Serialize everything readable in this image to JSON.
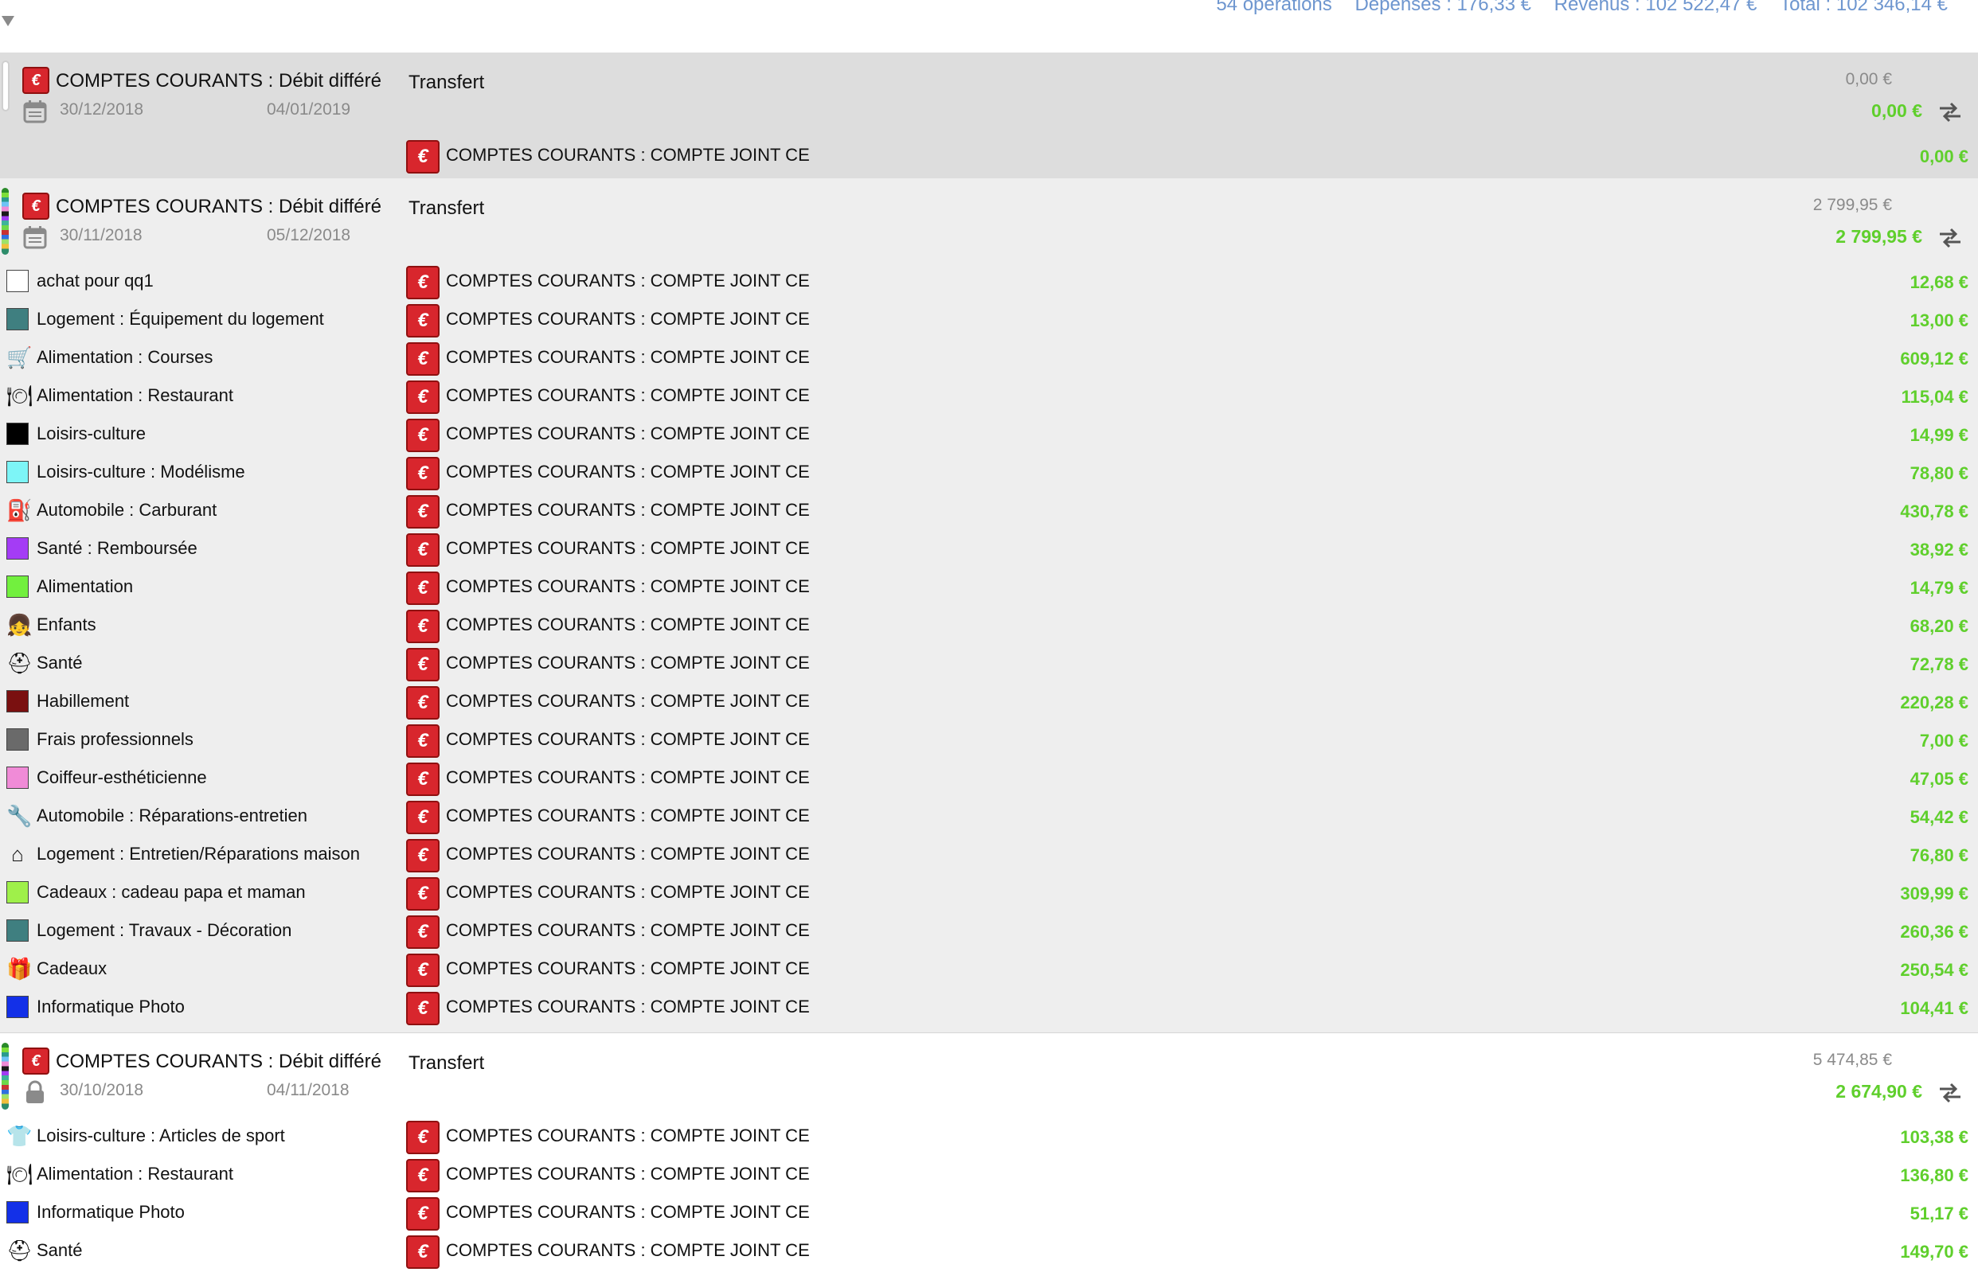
{
  "summary": {
    "operations": "54 opérations",
    "depenses": "Dépenses : 176,33 €",
    "revenus": "Revenus : 102 522,47 €",
    "total": "Total : 102 346,14 €"
  },
  "groups": [
    {
      "account": "COMPTES COURANTS : Débit différé",
      "type": "Transfert",
      "date_operation": "30/12/2018",
      "date_valeur": "04/01/2019",
      "gross": "0,00 €",
      "net": "0,00 €",
      "status_icon": "calendar-icon",
      "rows": [
        {
          "icon": "bank-logo",
          "label": "",
          "account": "COMPTES COURANTS : COMPTE JOINT CE",
          "amount": "0,00 €"
        }
      ]
    },
    {
      "account": "COMPTES COURANTS : Débit différé",
      "type": "Transfert",
      "date_operation": "30/11/2018",
      "date_valeur": "05/12/2018",
      "gross": "2 799,95 €",
      "net": "2 799,95 €",
      "status_icon": "calendar-icon",
      "rows": [
        {
          "icon": "white-swatch",
          "color": "#ffffff",
          "label": "achat pour qq1",
          "account": "COMPTES COURANTS : COMPTE JOINT CE",
          "amount": "12,68 €"
        },
        {
          "icon": "teal-swatch",
          "color": "#3f7f80",
          "label": "Logement : Équipement du logement",
          "account": "COMPTES COURANTS : COMPTE JOINT CE",
          "amount": "13,00 €"
        },
        {
          "icon": "shopping-cart-icon",
          "glyph": "🛒",
          "label": "Alimentation : Courses",
          "account": "COMPTES COURANTS : COMPTE JOINT CE",
          "amount": "609,12 €"
        },
        {
          "icon": "restaurant-icon",
          "glyph": "🍽",
          "label": "Alimentation : Restaurant",
          "account": "COMPTES COURANTS : COMPTE JOINT CE",
          "amount": "115,04 €"
        },
        {
          "icon": "black-swatch",
          "color": "#000000",
          "label": "Loisirs-culture",
          "account": "COMPTES COURANTS : COMPTE JOINT CE",
          "amount": "14,99 €"
        },
        {
          "icon": "cyan-swatch",
          "color": "#7df5f7",
          "label": "Loisirs-culture : Modélisme",
          "account": "COMPTES COURANTS : COMPTE JOINT CE",
          "amount": "78,80 €"
        },
        {
          "icon": "fuel-pump-icon",
          "glyph": "⛽",
          "label": "Automobile : Carburant",
          "account": "COMPTES COURANTS : COMPTE JOINT CE",
          "amount": "430,78 €"
        },
        {
          "icon": "purple-swatch",
          "color": "#a43cf5",
          "label": "Santé : Remboursée",
          "account": "COMPTES COURANTS : COMPTE JOINT CE",
          "amount": "38,92 €"
        },
        {
          "icon": "green-swatch",
          "color": "#72f03e",
          "label": "Alimentation",
          "account": "COMPTES COURANTS : COMPTE JOINT CE",
          "amount": "14,79 €"
        },
        {
          "icon": "child-photo-icon",
          "glyph": "👧",
          "label": "Enfants",
          "account": "COMPTES COURANTS : COMPTE JOINT CE",
          "amount": "68,20 €"
        },
        {
          "icon": "medical-kit-icon",
          "glyph": "⛑",
          "label": "Santé",
          "account": "COMPTES COURANTS : COMPTE JOINT CE",
          "amount": "72,78 €"
        },
        {
          "icon": "darkred-swatch",
          "color": "#7a1010",
          "label": "Habillement",
          "account": "COMPTES COURANTS : COMPTE JOINT CE",
          "amount": "220,28 €"
        },
        {
          "icon": "gray-swatch",
          "color": "#6a6a6a",
          "label": "Frais professionnels",
          "account": "COMPTES COURANTS : COMPTE JOINT CE",
          "amount": "7,00 €"
        },
        {
          "icon": "pink-swatch",
          "color": "#f08bd7",
          "label": "Coiffeur-esthéticienne",
          "account": "COMPTES COURANTS : COMPTE JOINT CE",
          "amount": "47,05 €"
        },
        {
          "icon": "car-repair-icon",
          "glyph": "🔧",
          "label": "Automobile : Réparations-entretien",
          "account": "COMPTES COURANTS : COMPTE JOINT CE",
          "amount": "54,42 €"
        },
        {
          "icon": "house-repair-icon",
          "glyph": "⌂",
          "label": "Logement : Entretien/Réparations maison",
          "account": "COMPTES COURANTS : COMPTE JOINT CE",
          "amount": "76,80 €"
        },
        {
          "icon": "lime-swatch",
          "color": "#9ff04a",
          "label": "Cadeaux : cadeau papa et maman",
          "account": "COMPTES COURANTS : COMPTE JOINT CE",
          "amount": "309,99 €"
        },
        {
          "icon": "teal-swatch",
          "color": "#3f7f80",
          "label": "Logement : Travaux - Décoration",
          "account": "COMPTES COURANTS : COMPTE JOINT CE",
          "amount": "260,36 €"
        },
        {
          "icon": "gift-icon",
          "glyph": "🎁",
          "label": "Cadeaux",
          "account": "COMPTES COURANTS : COMPTE JOINT CE",
          "amount": "250,54 €"
        },
        {
          "icon": "blue-swatch",
          "color": "#1330e8",
          "label": "Informatique Photo",
          "account": "COMPTES COURANTS : COMPTE JOINT CE",
          "amount": "104,41 €"
        }
      ]
    },
    {
      "account": "COMPTES COURANTS : Débit différé",
      "type": "Transfert",
      "date_operation": "30/10/2018",
      "date_valeur": "04/11/2018",
      "gross": "5 474,85 €",
      "net": "2 674,90 €",
      "status_icon": "lock-icon",
      "rows": [
        {
          "icon": "sport-shirt-icon",
          "glyph": "👕",
          "label": "Loisirs-culture : Articles de sport",
          "account": "COMPTES COURANTS : COMPTE JOINT CE",
          "amount": "103,38 €"
        },
        {
          "icon": "restaurant-icon",
          "glyph": "🍽",
          "label": "Alimentation : Restaurant",
          "account": "COMPTES COURANTS : COMPTE JOINT CE",
          "amount": "136,80 €"
        },
        {
          "icon": "blue-swatch",
          "color": "#1330e8",
          "label": "Informatique Photo",
          "account": "COMPTES COURANTS : COMPTE JOINT CE",
          "amount": "51,17 €"
        },
        {
          "icon": "medical-kit-icon",
          "glyph": "⛑",
          "label": "Santé",
          "account": "COMPTES COURANTS : COMPTE JOINT CE",
          "amount": "149,70 €"
        }
      ]
    }
  ],
  "colors": {
    "summary_text": "#6e96cf",
    "amount_green": "#5fcf2c",
    "bank_red": "#d8262d"
  }
}
